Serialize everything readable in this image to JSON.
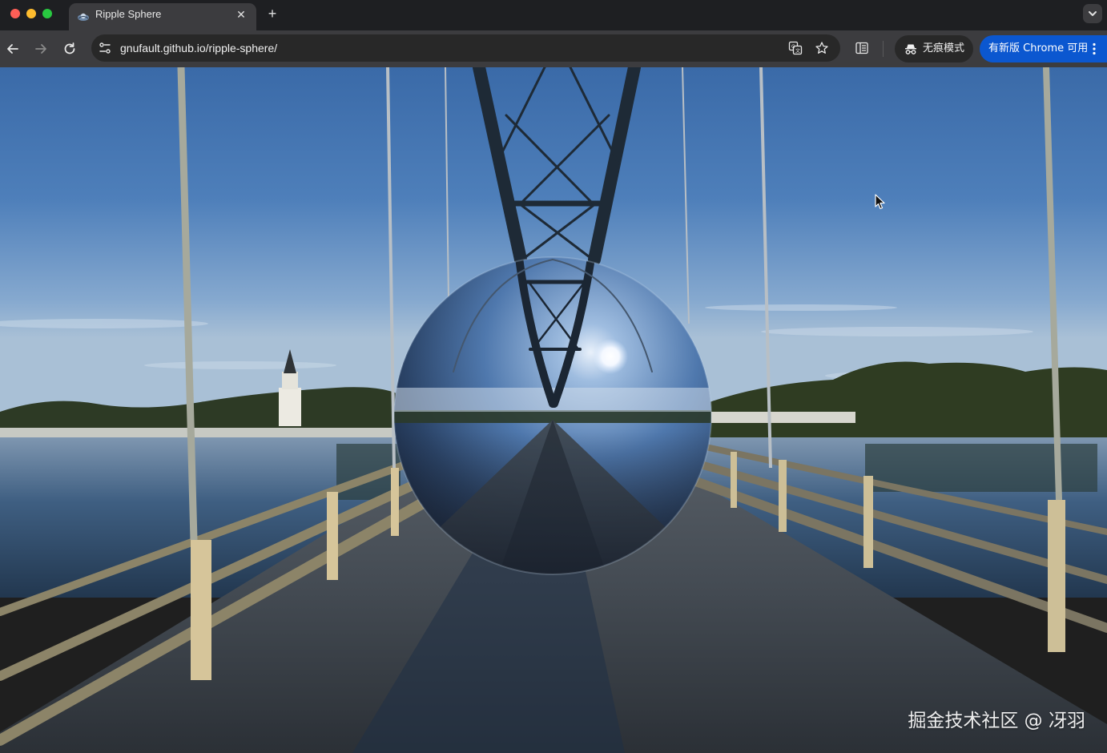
{
  "browser": {
    "tab": {
      "title": "Ripple Sphere",
      "close_glyph": "✕",
      "favicon": "ripple-sphere-favicon"
    },
    "new_tab_glyph": "+",
    "address_bar": {
      "url": "gnufault.github.io/ripple-sphere/"
    },
    "incognito": {
      "label": "无痕模式",
      "icon": "incognito-icon"
    },
    "update": {
      "label": "有新版 Chrome 可用"
    },
    "colors": {
      "tab_strip": "#1e1f22",
      "toolbar": "#3c3c3f",
      "omnibox": "#282828",
      "update_button": "#0b57d0"
    }
  },
  "page": {
    "scene": "reflective chrome sphere on a suspension bridge",
    "watermark": "掘金技术社区 @ 冴羽"
  }
}
